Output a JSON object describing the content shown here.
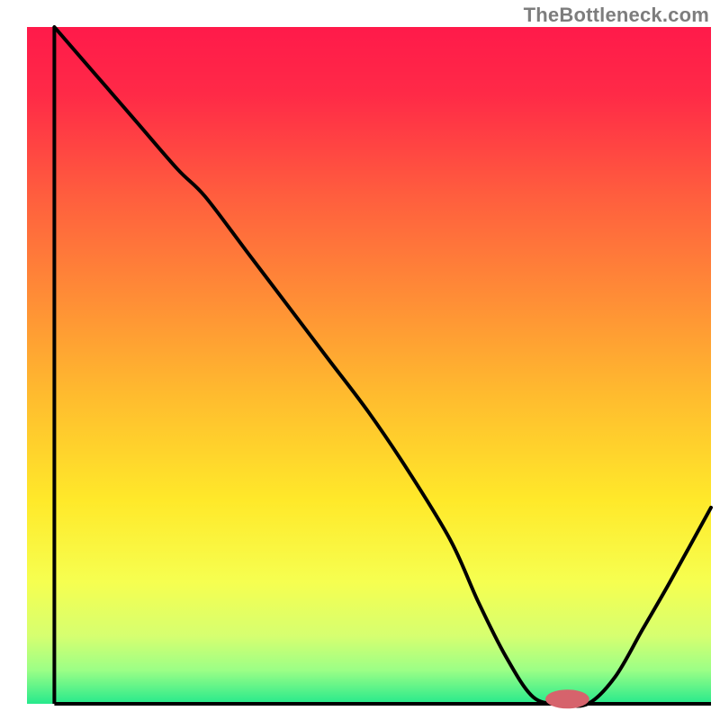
{
  "attribution": "TheBottleneck.com",
  "chart_data": {
    "type": "line",
    "title": "",
    "xlabel": "",
    "ylabel": "",
    "xlim": [
      0,
      100
    ],
    "ylim": [
      0,
      100
    ],
    "grid": false,
    "legend": false,
    "background_gradient": {
      "stops": [
        {
          "offset": 0.0,
          "color": "#ff1a4a"
        },
        {
          "offset": 0.1,
          "color": "#ff2a47"
        },
        {
          "offset": 0.25,
          "color": "#ff5e3e"
        },
        {
          "offset": 0.4,
          "color": "#ff8d36"
        },
        {
          "offset": 0.55,
          "color": "#ffbd2e"
        },
        {
          "offset": 0.7,
          "color": "#ffe92a"
        },
        {
          "offset": 0.82,
          "color": "#f6ff50"
        },
        {
          "offset": 0.9,
          "color": "#d6ff70"
        },
        {
          "offset": 0.95,
          "color": "#9cff86"
        },
        {
          "offset": 1.0,
          "color": "#26e98c"
        }
      ]
    },
    "series": [
      {
        "name": "bottleneck-curve",
        "color": "#000000",
        "x": [
          4,
          10,
          16,
          22,
          26,
          32,
          38,
          44,
          50,
          56,
          62,
          66,
          70,
          74,
          78,
          82,
          86,
          90,
          94,
          100
        ],
        "y": [
          100,
          93,
          86,
          79,
          75,
          67,
          59,
          51,
          43,
          34,
          24,
          15,
          7,
          1,
          0,
          0,
          4,
          11,
          18,
          29
        ]
      }
    ],
    "marker": {
      "name": "optimal-marker",
      "cx": 79,
      "cy": 0.7,
      "rx": 3.2,
      "ry": 1.4,
      "color": "#d6636c"
    },
    "axes": {
      "left": {
        "x1": 4,
        "y1": 0,
        "x2": 4,
        "y2": 100
      },
      "bottom": {
        "x1": 4,
        "y1": 0,
        "x2": 100,
        "y2": 0
      }
    }
  }
}
